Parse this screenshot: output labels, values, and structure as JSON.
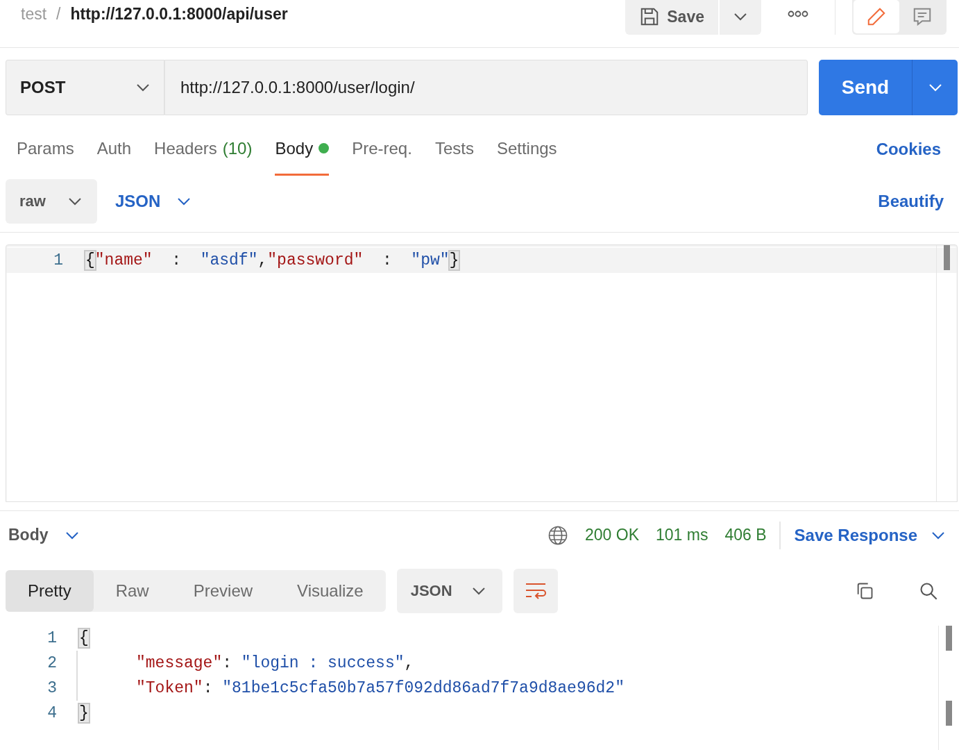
{
  "breadcrumb": {
    "collection": "test",
    "separator": "/",
    "request_name": "http://127.0.0.1:8000/api/user"
  },
  "header_actions": {
    "save_label": "Save",
    "modes": [
      {
        "kind": "edit",
        "selected": true
      },
      {
        "kind": "comments",
        "selected": false
      }
    ]
  },
  "request": {
    "method": "POST",
    "url": "http://127.0.0.1:8000/user/login/",
    "send_label": "Send"
  },
  "request_tabs": [
    {
      "label": "Params",
      "selected": false
    },
    {
      "label": "Auth",
      "selected": false
    },
    {
      "label": "Headers",
      "count": "(10)",
      "selected": false
    },
    {
      "label": "Body",
      "dot": true,
      "selected": true
    },
    {
      "label": "Pre-req.",
      "selected": false
    },
    {
      "label": "Tests",
      "selected": false
    },
    {
      "label": "Settings",
      "selected": false
    }
  ],
  "cookies_link": "Cookies",
  "body_options": {
    "mode": "raw",
    "language": "JSON",
    "beautify": "Beautify"
  },
  "request_body": [
    {
      "number": "1",
      "tokens": [
        {
          "kind": "brace",
          "text": "{"
        },
        {
          "kind": "key",
          "text": "\"name\""
        },
        {
          "kind": "punct",
          "text": "  :  "
        },
        {
          "kind": "string",
          "text": "\"asdf\""
        },
        {
          "kind": "punct",
          "text": ","
        },
        {
          "kind": "key",
          "text": "\"password\""
        },
        {
          "kind": "punct",
          "text": "  :  "
        },
        {
          "kind": "string",
          "text": "\"pw\""
        },
        {
          "kind": "brace",
          "text": "}"
        }
      ]
    }
  ],
  "response_bar": {
    "section": "Body",
    "status": "200 OK",
    "time": "101 ms",
    "size": "406 B",
    "save_label": "Save Response"
  },
  "response_tabs": [
    {
      "label": "Pretty",
      "selected": true
    },
    {
      "label": "Raw",
      "selected": false
    },
    {
      "label": "Preview",
      "selected": false
    },
    {
      "label": "Visualize",
      "selected": false
    }
  ],
  "response_format": "JSON",
  "response_body": [
    {
      "number": "1",
      "tokens": [
        {
          "kind": "brace",
          "text": "{"
        }
      ]
    },
    {
      "number": "2",
      "indented": true,
      "tokens": [
        {
          "kind": "key",
          "text": "\"message\""
        },
        {
          "kind": "punct",
          "text": ": "
        },
        {
          "kind": "string",
          "text": "\"login : success\""
        },
        {
          "kind": "punct",
          "text": ","
        }
      ]
    },
    {
      "number": "3",
      "indented": true,
      "tokens": [
        {
          "kind": "key",
          "text": "\"Token\""
        },
        {
          "kind": "punct",
          "text": ": "
        },
        {
          "kind": "string",
          "text": "\"81be1c5cfa50b7a57f092dd86ad7f7a9d8ae96d2\""
        }
      ]
    },
    {
      "number": "4",
      "tokens": [
        {
          "kind": "brace",
          "text": "}"
        }
      ]
    }
  ]
}
